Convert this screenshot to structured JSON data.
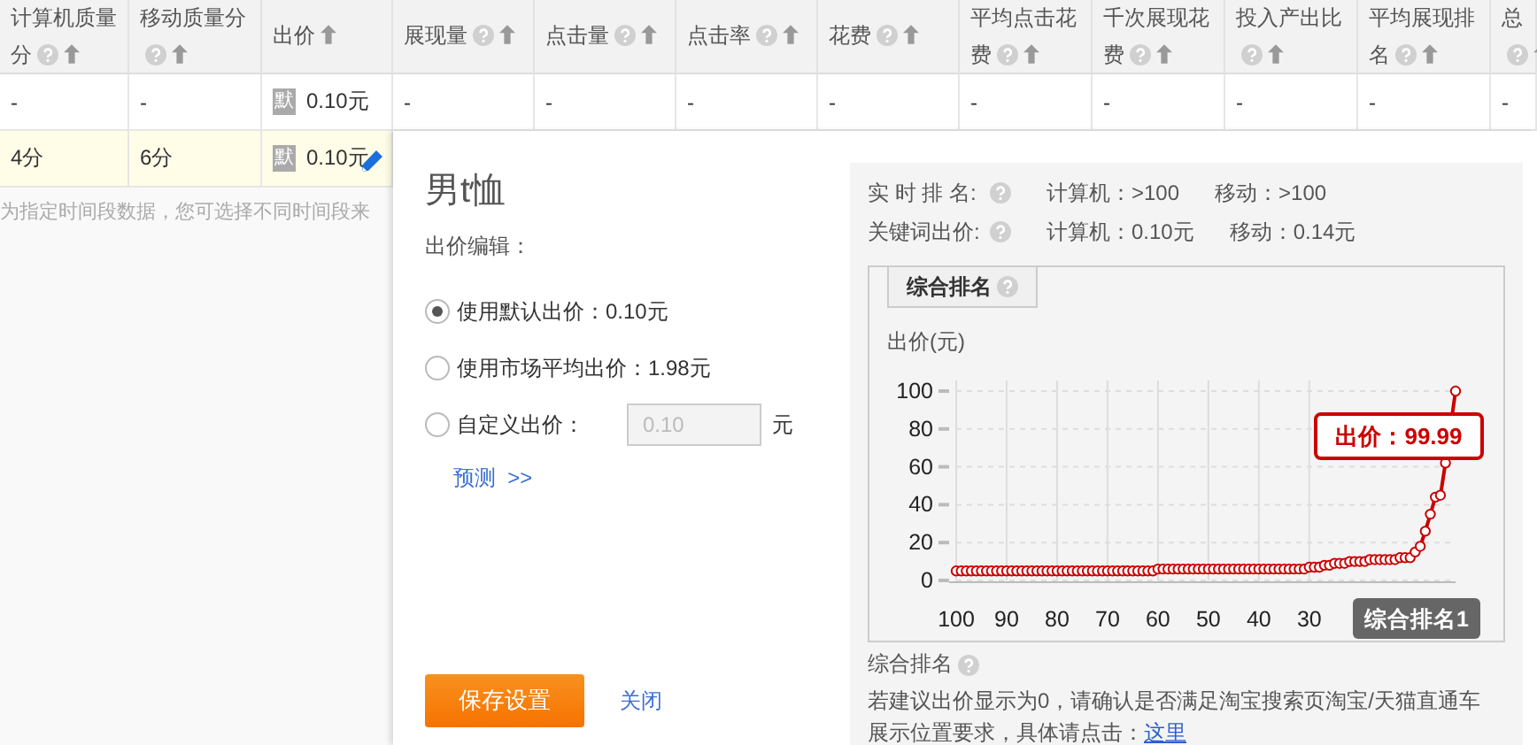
{
  "table": {
    "columns": [
      {
        "label": "计算机质量分",
        "help": true
      },
      {
        "label": "移动质量分",
        "help": true
      },
      {
        "label": "出价",
        "help": false
      },
      {
        "label": "展现量",
        "help": true
      },
      {
        "label": "点击量",
        "help": true
      },
      {
        "label": "点击率",
        "help": true
      },
      {
        "label": "花费",
        "help": true
      },
      {
        "label": "平均点击花费",
        "help": true
      },
      {
        "label": "千次展现花费",
        "help": true
      },
      {
        "label": "投入产出比",
        "help": true
      },
      {
        "label": "平均展现排名",
        "help": true
      },
      {
        "label": "总",
        "help": true
      }
    ],
    "rows": [
      {
        "selected": false,
        "cells": [
          {
            "kind": "text",
            "text": "-"
          },
          {
            "kind": "text",
            "text": "-"
          },
          {
            "kind": "bid",
            "badge": "默",
            "text": "0.10元"
          },
          {
            "kind": "text",
            "text": "-"
          },
          {
            "kind": "text",
            "text": "-"
          },
          {
            "kind": "text",
            "text": "-"
          },
          {
            "kind": "text",
            "text": "-"
          },
          {
            "kind": "text",
            "text": "-"
          },
          {
            "kind": "text",
            "text": "-"
          },
          {
            "kind": "text",
            "text": "-"
          },
          {
            "kind": "text",
            "text": "-"
          },
          {
            "kind": "text",
            "text": "-"
          }
        ]
      },
      {
        "selected": true,
        "cells": [
          {
            "kind": "text",
            "text": "4分"
          },
          {
            "kind": "text",
            "text": "6分"
          },
          {
            "kind": "bid",
            "badge": "默",
            "text": "0.10元"
          }
        ]
      }
    ]
  },
  "note": "为指定时间段数据，您可选择不同时间段来",
  "popup": {
    "title": "男t恤",
    "bid_label": "出价编辑：",
    "options": [
      {
        "kind": "radio",
        "label": "使用默认出价：0.10元",
        "selected": true
      },
      {
        "kind": "radio",
        "label": "使用市场平均出价：1.98元",
        "selected": false
      },
      {
        "kind": "custom",
        "label": "自定义出价：",
        "selected": false,
        "value": "0.10",
        "disabled": true,
        "unit": "元"
      }
    ],
    "forecast_link": "预测  >>",
    "save_button": "保存设置",
    "close_link": "关闭",
    "rank_info": [
      {
        "label": "实 时 排 名:",
        "computer": "计算机：>100",
        "mobile": "移动：>100"
      },
      {
        "label": "关键词出价:",
        "computer": "计算机：0.10元",
        "mobile": "移动：0.14元"
      }
    ],
    "chart_tab": {
      "label": "综合排名",
      "selected": true
    },
    "chart_data": {
      "type": "line",
      "ylabel": "出价(元)",
      "xlim": [
        100,
        1
      ],
      "ylim": [
        0,
        100
      ],
      "grid": true,
      "xticks": [
        100,
        90,
        80,
        70,
        60,
        50,
        40,
        30
      ],
      "yticks": [
        0,
        20,
        40,
        60,
        80,
        100
      ],
      "x": [
        100,
        99,
        98,
        97,
        96,
        95,
        94,
        93,
        92,
        91,
        90,
        89,
        88,
        87,
        86,
        85,
        84,
        83,
        82,
        81,
        80,
        79,
        78,
        77,
        76,
        75,
        74,
        73,
        72,
        71,
        70,
        69,
        68,
        67,
        66,
        65,
        64,
        63,
        62,
        61,
        60,
        59,
        58,
        57,
        56,
        55,
        54,
        53,
        52,
        51,
        50,
        49,
        48,
        47,
        46,
        45,
        44,
        43,
        42,
        41,
        40,
        39,
        38,
        37,
        36,
        35,
        34,
        33,
        32,
        31,
        30,
        29,
        28,
        27,
        26,
        25,
        24,
        23,
        22,
        21,
        20,
        19,
        18,
        17,
        16,
        15,
        14,
        13,
        12,
        11,
        10,
        9,
        8,
        7,
        6,
        5,
        4,
        3,
        2,
        1
      ],
      "series": [
        {
          "color": "#cc0000",
          "marker": true,
          "values": [
            5,
            5,
            5,
            5,
            5,
            5,
            5,
            5,
            5,
            5,
            5,
            5,
            5,
            5,
            5,
            5,
            5,
            5,
            5,
            5,
            5,
            5,
            5,
            5,
            5,
            5,
            5,
            5,
            5,
            5,
            5,
            5,
            5,
            5,
            5,
            5,
            5,
            5,
            5,
            5,
            6,
            6,
            6,
            6,
            6,
            6,
            6,
            6,
            6,
            6,
            6,
            6,
            6,
            6,
            6,
            6,
            6,
            6,
            6,
            6,
            6,
            6,
            6,
            6,
            6,
            6,
            6,
            6,
            6,
            6,
            7,
            7,
            7,
            8,
            8,
            9,
            9,
            9,
            10,
            10,
            10,
            10,
            11,
            11,
            11,
            11,
            11,
            11,
            12,
            12,
            12,
            15,
            18,
            26,
            35,
            44,
            45,
            62,
            null,
            99.99
          ]
        }
      ],
      "annotations": [
        "出价：99.99",
        "综合排名1"
      ]
    },
    "footnote": {
      "title": "综合排名",
      "text": "若建议出价显示为0，请确认是否满足淘宝搜索页淘宝/天猫直通车展示位置要求，具体请点击：",
      "link": "这里"
    }
  }
}
